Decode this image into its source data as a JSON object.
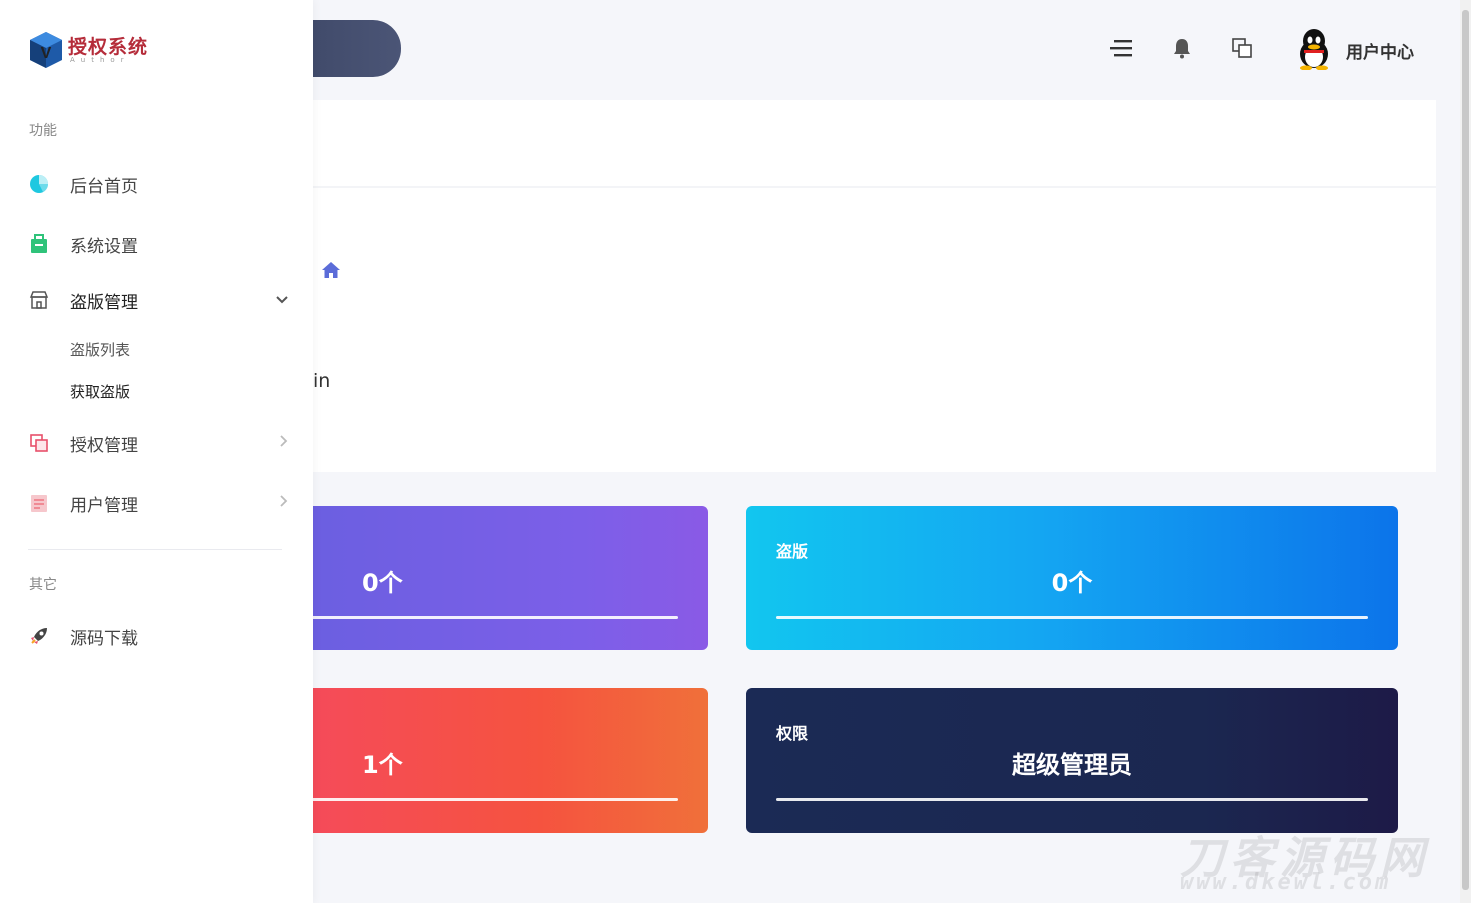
{
  "header": {
    "user_label": "用户中心",
    "icons": [
      "menu-icon",
      "bell-icon",
      "window-icon",
      "qq-avatar-icon"
    ]
  },
  "logo": {
    "title": "授权系统",
    "subtitle": "Author"
  },
  "sidebar": {
    "section_functions": "功能",
    "items": [
      {
        "label": "后台首页",
        "icon": "dashboard-icon",
        "color": "#1ec8e0"
      },
      {
        "label": "系统设置",
        "icon": "settings-box-icon",
        "color": "#2fc37a"
      },
      {
        "label": "盗版管理",
        "icon": "store-icon",
        "color": "#666666",
        "expanded": true,
        "children": [
          {
            "label": "盗版列表"
          },
          {
            "label": "获取盗版"
          }
        ]
      },
      {
        "label": "授权管理",
        "icon": "copy-icon",
        "color": "#e8506a"
      },
      {
        "label": "用户管理",
        "icon": "user-list-icon",
        "color": "#f08a94"
      }
    ],
    "section_other": "其它",
    "other_items": [
      {
        "label": "源码下载",
        "icon": "rocket-icon"
      }
    ]
  },
  "main": {
    "partial_text": "in",
    "cards": [
      {
        "label": "",
        "value": "0个"
      },
      {
        "label": "盗版",
        "value": "0个"
      },
      {
        "label": "",
        "value": "1个"
      },
      {
        "label": "权限",
        "value": "超级管理员"
      }
    ]
  },
  "watermark": {
    "line1": "刀客源码网",
    "line2": "www.dkewl.com"
  },
  "colors": {
    "accent": "#5b6cd8",
    "header_pill": "#3f4a6b"
  }
}
